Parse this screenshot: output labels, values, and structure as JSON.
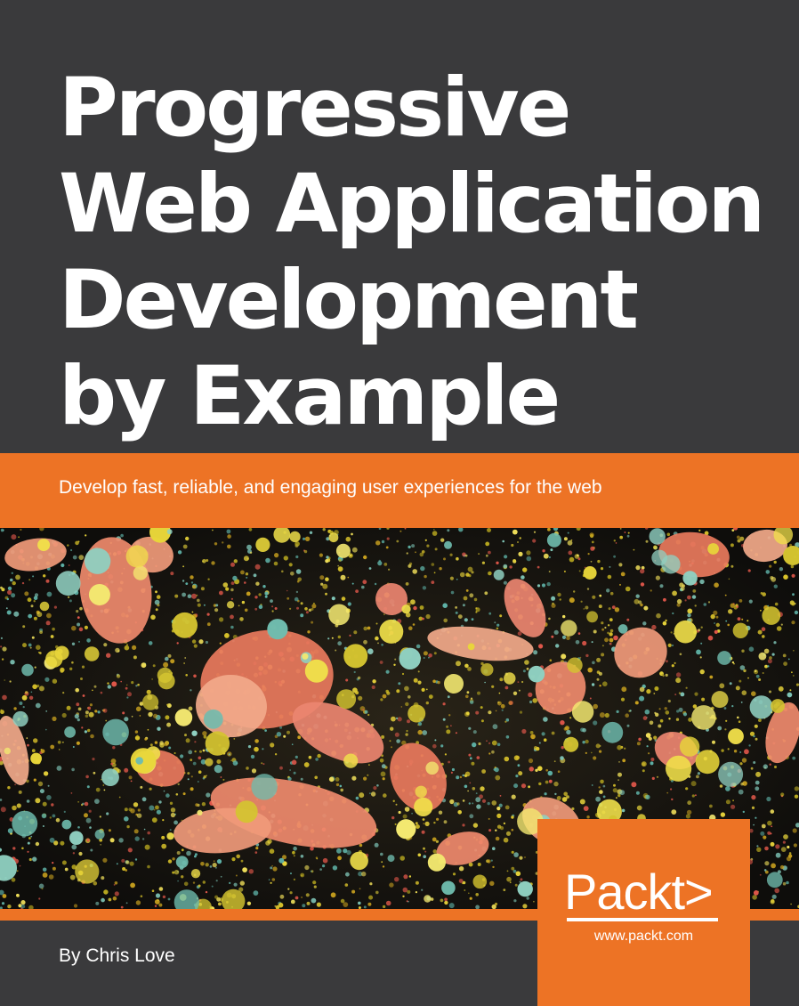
{
  "cover": {
    "title_lines": [
      "Progressive",
      "Web Application",
      "Development",
      "by Example"
    ],
    "subtitle": "Develop fast, reliable, and engaging user experiences for the web",
    "author": "By Chris Love",
    "publisher": {
      "name": "Packt>",
      "url": "www.packt.com"
    }
  },
  "colors": {
    "background": "#3a3a3c",
    "accent": "#ed7325",
    "text": "#ffffff"
  }
}
